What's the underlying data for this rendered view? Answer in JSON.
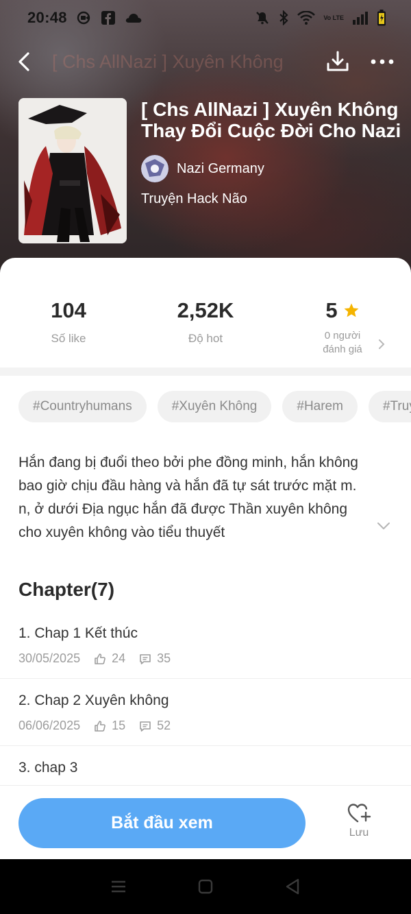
{
  "status_bar": {
    "time": "20:48",
    "left_icons": [
      "screen-record-icon",
      "facebook-icon",
      "cloud-icon"
    ],
    "right_icons": [
      "mute-icon",
      "bluetooth-icon",
      "wifi-icon",
      "volte-icon",
      "signal-icon",
      "battery-icon"
    ],
    "volte_text": "Vo LTE"
  },
  "top_nav": {
    "faded_title": "[ Chs AllNazi ] Xuyên Không",
    "icons": [
      "back-icon",
      "download-icon",
      "more-icon"
    ]
  },
  "book": {
    "title": "[ Chs AllNazi ] Xuyên Không Thay Đổi Cuộc Đời Cho Nazi",
    "author": "Nazi Germany",
    "category": "Truyện Hack Não"
  },
  "stats": [
    {
      "value": "104",
      "label": "Số like"
    },
    {
      "value": "2,52K",
      "label": "Độ hot"
    },
    {
      "value": "5",
      "label": "0 người đánh giá",
      "icon": "star-icon"
    }
  ],
  "tags": [
    "#Countryhumans",
    "#Xuyên Không",
    "#Harem",
    "#Truyện"
  ],
  "synopsis": "Hắn đang bị đuổi theo bởi phe đồng minh, hắn không bao giờ chịu đầu hàng và hắn đã tự sát trước mặt m. n, ở  dưới Địa ngục hắn đã được Thần xuyên không cho xuyên không vào tiểu thuyết",
  "chapters": {
    "heading": "Chapter(7)",
    "items": [
      {
        "title": "1. Chap 1 Kết thúc",
        "date": "30/05/2025",
        "likes": "24",
        "comments": "35"
      },
      {
        "title": "2. Chap 2 Xuyên không",
        "date": "06/06/2025",
        "likes": "15",
        "comments": "52"
      },
      {
        "title": "3. chap 3",
        "date": "",
        "likes": "",
        "comments": ""
      }
    ]
  },
  "actions": {
    "start_label": "Bắt đầu xem",
    "save_label": "Lưu"
  },
  "colors": {
    "accent": "#5aa9f5",
    "star": "#f5b400"
  }
}
